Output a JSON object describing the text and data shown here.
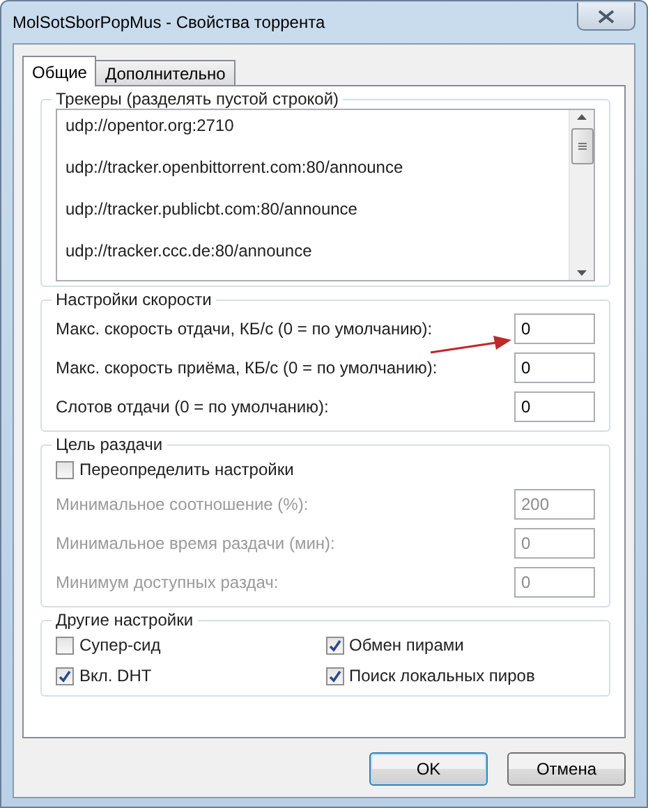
{
  "window": {
    "title": "MolSotSborPopMus - Свойства торрента"
  },
  "tabs": [
    {
      "label": "Общие",
      "selected": true
    },
    {
      "label": "Дополнительно",
      "selected": false
    }
  ],
  "trackers": {
    "title": "Трекеры (разделять пустой строкой)",
    "items": [
      "udp://opentor.org:2710",
      "udp://tracker.openbittorrent.com:80/announce",
      "udp://tracker.publicbt.com:80/announce",
      "udp://tracker.ccc.de:80/announce"
    ]
  },
  "speed": {
    "title": "Настройки скорости",
    "fields": [
      {
        "label": "Макс. скорость отдачи, КБ/с (0 = по умолчанию):",
        "value": "0"
      },
      {
        "label": "Макс. скорость приёма, КБ/с (0 = по умолчанию):",
        "value": "0"
      },
      {
        "label": "Слотов отдачи (0 = по умолчанию):",
        "value": "0"
      }
    ]
  },
  "seeding": {
    "title": "Цель раздачи",
    "override": {
      "label": "Переопределить настройки",
      "checked": false
    },
    "fields": [
      {
        "label": "Минимальное соотношение (%):",
        "value": "200",
        "disabled": true
      },
      {
        "label": "Минимальное время раздачи (мин):",
        "value": "0",
        "disabled": true
      },
      {
        "label": "Минимум доступных раздач:",
        "value": "0",
        "disabled": true
      }
    ]
  },
  "other": {
    "title": "Другие настройки",
    "options": [
      {
        "label": "Супер-сид",
        "checked": false
      },
      {
        "label": "Обмен пирами",
        "checked": true
      },
      {
        "label": "Вкл. DHT",
        "checked": true
      },
      {
        "label": "Поиск локальных пиров",
        "checked": true
      }
    ]
  },
  "buttons": [
    {
      "label": "OK",
      "kind": "default"
    },
    {
      "label": "Отмена",
      "kind": "normal"
    }
  ]
}
